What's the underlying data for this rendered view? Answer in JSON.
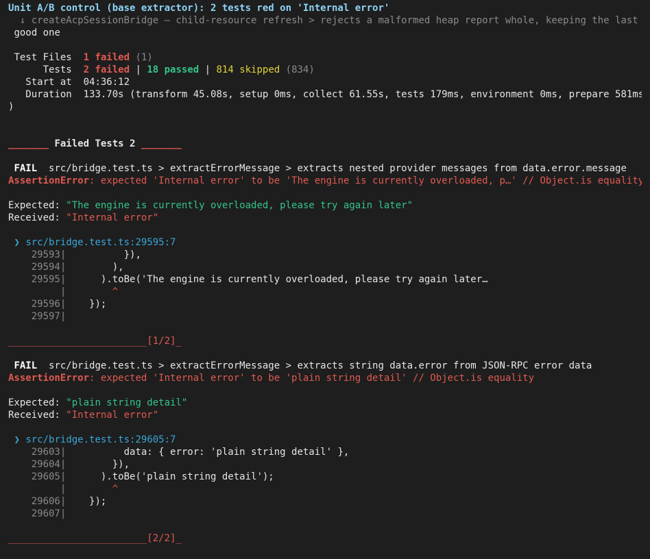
{
  "header": {
    "title": "Unit A/B control (base extractor): 2 tests red on 'Internal error'",
    "skipped_line": "  ↓ createAcpSessionBridge — child-resource refresh > rejects a malformed heap report whole, keeping the last",
    "skipped_line_cont": "good one"
  },
  "summary": {
    "test_files_label": "Test Files",
    "test_files_failed": "1 failed",
    "test_files_total": "(1)",
    "tests_label": "Tests",
    "tests_failed": "2 failed",
    "tests_passed": "18 passed",
    "tests_skipped": "814 skipped",
    "tests_total": "(834)",
    "start_label": "Start at",
    "start_value": "04:36:12",
    "duration_label": "Duration",
    "duration_value": "133.70s (transform 45.08s, setup 0ms, collect 61.55s, tests 179ms, environment 0ms, prepare 581ms",
    "duration_cont": ")"
  },
  "failed_header": {
    "left_bar": "_______",
    "text": "Failed Tests 2",
    "right_bar": "_______"
  },
  "failures": [
    {
      "fail_tag": "FAIL",
      "path": "src/bridge.test.ts > extractErrorMessage > extracts nested provider messages from data.error.message",
      "error_name": "AssertionError",
      "error_msg": ": expected 'Internal error' to be 'The engine is currently overloaded, p…' // Object.is equality",
      "expected_label": "Expected: ",
      "expected_value": "\"The engine is currently overloaded, please try again later\"",
      "received_label": "Received: ",
      "received_value": "\"Internal error\"",
      "location_arrow": "❯",
      "location": "src/bridge.test.ts:29595:7",
      "code": [
        {
          "no": "29593|",
          "text": "          }),"
        },
        {
          "no": "29594|",
          "text": "        ),"
        },
        {
          "no": "29595|",
          "text": "      ).toBe('The engine is currently overloaded, please try again later…"
        },
        {
          "no": "     |",
          "text": "        ^",
          "caret": true
        },
        {
          "no": "29596|",
          "text": "    });"
        },
        {
          "no": "29597|",
          "text": ""
        }
      ],
      "separator": "________________________[1/2]_"
    },
    {
      "fail_tag": "FAIL",
      "path": "src/bridge.test.ts > extractErrorMessage > extracts string data.error from JSON-RPC error data",
      "error_name": "AssertionError",
      "error_msg": ": expected 'Internal error' to be 'plain string detail' // Object.is equality",
      "expected_label": "Expected: ",
      "expected_value": "\"plain string detail\"",
      "received_label": "Received: ",
      "received_value": "\"Internal error\"",
      "location_arrow": "❯",
      "location": "src/bridge.test.ts:29605:7",
      "code": [
        {
          "no": "29603|",
          "text": "          data: { error: 'plain string detail' },"
        },
        {
          "no": "29604|",
          "text": "        }),"
        },
        {
          "no": "29605|",
          "text": "      ).toBe('plain string detail');"
        },
        {
          "no": "     |",
          "text": "        ^",
          "caret": true
        },
        {
          "no": "29606|",
          "text": "    });"
        },
        {
          "no": "29607|",
          "text": ""
        }
      ],
      "separator": "________________________[2/2]_"
    }
  ]
}
